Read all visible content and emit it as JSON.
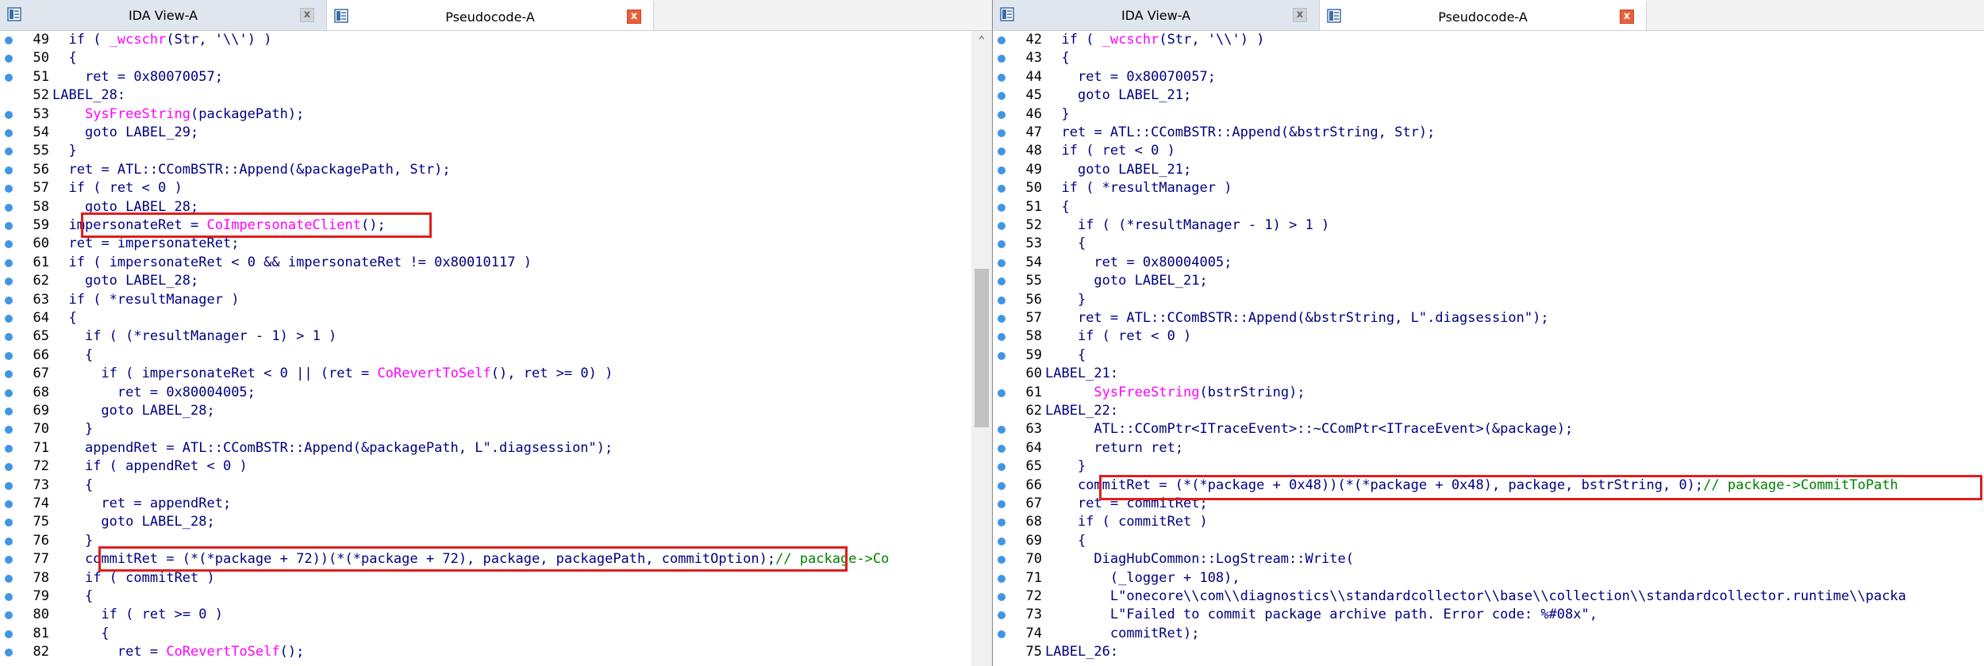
{
  "left": {
    "tabs": [
      {
        "label": "IDA View-A",
        "close": "x",
        "active": false
      },
      {
        "label": "Pseudocode-A",
        "close": "x",
        "active": true
      }
    ],
    "lines": [
      {
        "n": "49",
        "code": "  <span class='k'>if</span> ( <span class='f'>_wcschr</span>(<span class='v'>Str</span>, '\\\\') )"
      },
      {
        "n": "50",
        "code": "  {"
      },
      {
        "n": "51",
        "code": "    <span class='v'>ret</span> = 0x80070057;"
      },
      {
        "n": "52",
        "code": "LABEL_28:",
        "label": true
      },
      {
        "n": "53",
        "code": "    <span class='f'>SysFreeString</span>(<span class='v'>packagePath</span>);"
      },
      {
        "n": "54",
        "code": "    <span class='k'>goto</span> LABEL_29;"
      },
      {
        "n": "55",
        "code": "  }"
      },
      {
        "n": "56",
        "code": "  <span class='v'>ret</span> = ATL::CComBSTR::Append(&amp;<span class='v'>packagePath</span>, <span class='v'>Str</span>);"
      },
      {
        "n": "57",
        "code": "  <span class='k'>if</span> ( <span class='v'>ret</span> &lt; 0 )"
      },
      {
        "n": "58",
        "code": "    <span class='k'>goto</span> LABEL_28;"
      },
      {
        "n": "59",
        "code": "  <span class='v'>impersonateRet</span> = <span class='f'>CoImpersonateClient</span>();"
      },
      {
        "n": "60",
        "code": "  <span class='v'>ret</span> = <span class='v'>impersonateRet</span>;"
      },
      {
        "n": "61",
        "code": "  <span class='k'>if</span> ( <span class='v'>impersonateRet</span> &lt; 0 &amp;&amp; <span class='v'>impersonateRet</span> != 0x80010117 )"
      },
      {
        "n": "62",
        "code": "    <span class='k'>goto</span> LABEL_28;"
      },
      {
        "n": "63",
        "code": "  <span class='k'>if</span> ( *<span class='v'>resultManager</span> )"
      },
      {
        "n": "64",
        "code": "  {"
      },
      {
        "n": "65",
        "code": "    <span class='k'>if</span> ( (*<span class='v'>resultManager</span> - 1) &gt; 1 )"
      },
      {
        "n": "66",
        "code": "    {"
      },
      {
        "n": "67",
        "code": "      <span class='k'>if</span> ( <span class='v'>impersonateRet</span> &lt; 0 || (<span class='v'>ret</span> = <span class='f'>CoRevertToSelf</span>(), <span class='v'>ret</span> &gt;= 0) )"
      },
      {
        "n": "68",
        "code": "        <span class='v'>ret</span> = 0x80004005;"
      },
      {
        "n": "69",
        "code": "      <span class='k'>goto</span> LABEL_28;"
      },
      {
        "n": "70",
        "code": "    }"
      },
      {
        "n": "71",
        "code": "    <span class='v'>appendRet</span> = ATL::CComBSTR::Append(&amp;<span class='v'>packagePath</span>, L\".diagsession\");"
      },
      {
        "n": "72",
        "code": "    <span class='k'>if</span> ( <span class='v'>appendRet</span> &lt; 0 )"
      },
      {
        "n": "73",
        "code": "    {"
      },
      {
        "n": "74",
        "code": "      <span class='v'>ret</span> = <span class='v'>appendRet</span>;"
      },
      {
        "n": "75",
        "code": "      <span class='k'>goto</span> LABEL_28;"
      },
      {
        "n": "76",
        "code": "    }"
      },
      {
        "n": "77",
        "code": "    <span class='v'>commitRet</span> = (*(*<span class='v'>package</span> + 72))(*(*<span class='v'>package</span> + 72), <span class='v'>package</span>, <span class='v'>packagePath</span>, <span class='v'>commitOption</span>);<span class='c'>// package-&gt;Co</span>"
      },
      {
        "n": "78",
        "code": "    <span class='k'>if</span> ( <span class='v'>commitRet</span> )"
      },
      {
        "n": "79",
        "code": "    {"
      },
      {
        "n": "80",
        "code": "      <span class='k'>if</span> ( <span class='v'>ret</span> &gt;= 0 )"
      },
      {
        "n": "81",
        "code": "      {"
      },
      {
        "n": "82",
        "code": "        <span class='v'>ret</span> = <span class='f'>CoRevertToSelf</span>();"
      }
    ]
  },
  "right": {
    "tabs": [
      {
        "label": "IDA View-A",
        "close": "x",
        "active": false
      },
      {
        "label": "Pseudocode-A",
        "close": "x",
        "active": true
      }
    ],
    "lines": [
      {
        "n": "42",
        "code": "  <span class='k'>if</span> ( <span class='f'>_wcschr</span>(<span class='v'>Str</span>, '\\\\') )"
      },
      {
        "n": "43",
        "code": "  {"
      },
      {
        "n": "44",
        "code": "    <span class='v'>ret</span> = 0x80070057;"
      },
      {
        "n": "45",
        "code": "    <span class='k'>goto</span> LABEL_21;"
      },
      {
        "n": "46",
        "code": "  }"
      },
      {
        "n": "47",
        "code": "  <span class='v'>ret</span> = ATL::CComBSTR::Append(&amp;<span class='v'>bstrString</span>, <span class='v'>Str</span>);"
      },
      {
        "n": "48",
        "code": "  <span class='k'>if</span> ( <span class='v'>ret</span> &lt; 0 )"
      },
      {
        "n": "49",
        "code": "    <span class='k'>goto</span> LABEL_21;"
      },
      {
        "n": "50",
        "code": "  <span class='k'>if</span> ( *<span class='v'>resultManager</span> )"
      },
      {
        "n": "51",
        "code": "  {"
      },
      {
        "n": "52",
        "code": "    <span class='k'>if</span> ( (*<span class='v'>resultManager</span> - 1) &gt; 1 )"
      },
      {
        "n": "53",
        "code": "    {"
      },
      {
        "n": "54",
        "code": "      <span class='v'>ret</span> = 0x80004005;"
      },
      {
        "n": "55",
        "code": "      <span class='k'>goto</span> LABEL_21;"
      },
      {
        "n": "56",
        "code": "    }"
      },
      {
        "n": "57",
        "code": "    <span class='v'>ret</span> = ATL::CComBSTR::Append(&amp;<span class='v'>bstrString</span>, L\".diagsession\");"
      },
      {
        "n": "58",
        "code": "    <span class='k'>if</span> ( <span class='v'>ret</span> &lt; 0 )"
      },
      {
        "n": "59",
        "code": "    {"
      },
      {
        "n": "60",
        "code": "LABEL_21:",
        "label": true
      },
      {
        "n": "61",
        "code": "      <span class='f'>SysFreeString</span>(<span class='v'>bstrString</span>);"
      },
      {
        "n": "62",
        "code": "LABEL_22:",
        "label": true
      },
      {
        "n": "63",
        "code": "      ATL::CComPtr&lt;ITraceEvent&gt;::~CComPtr&lt;ITraceEvent&gt;(&amp;<span class='v'>package</span>);"
      },
      {
        "n": "64",
        "code": "      <span class='k'>return</span> <span class='v'>ret</span>;"
      },
      {
        "n": "65",
        "code": "    }"
      },
      {
        "n": "66",
        "code": "    <span class='v'>commitRet</span> = (*(*<span class='v'>package</span> + 0x48))(*(*<span class='v'>package</span> + 0x48), <span class='v'>package</span>, <span class='v'>bstrString</span>, 0);<span class='c'>// package-&gt;CommitToPath</span>"
      },
      {
        "n": "67",
        "code": "    <span class='v'>ret</span> = <span class='v'>commitRet</span>;"
      },
      {
        "n": "68",
        "code": "    <span class='k'>if</span> ( <span class='v'>commitRet</span> )"
      },
      {
        "n": "69",
        "code": "    {"
      },
      {
        "n": "70",
        "code": "      DiagHubCommon::LogStream::Write("
      },
      {
        "n": "71",
        "code": "        (_logger + 108),"
      },
      {
        "n": "72",
        "code": "        L\"onecore\\\\com\\\\diagnostics\\\\standardcollector\\\\base\\\\collection\\\\standardcollector.runtime\\\\packa"
      },
      {
        "n": "73",
        "code": "        L\"Failed to commit package archive path. Error code: %#08x\","
      },
      {
        "n": "74",
        "code": "        <span class='v'>commitRet</span>);"
      },
      {
        "n": "75",
        "code": "LABEL_26:",
        "label": true
      }
    ]
  },
  "colors": {
    "highlight": "#e11d1d",
    "breakpoint": "#3f96e3",
    "function": "#ff00ff",
    "comment": "#008000"
  }
}
